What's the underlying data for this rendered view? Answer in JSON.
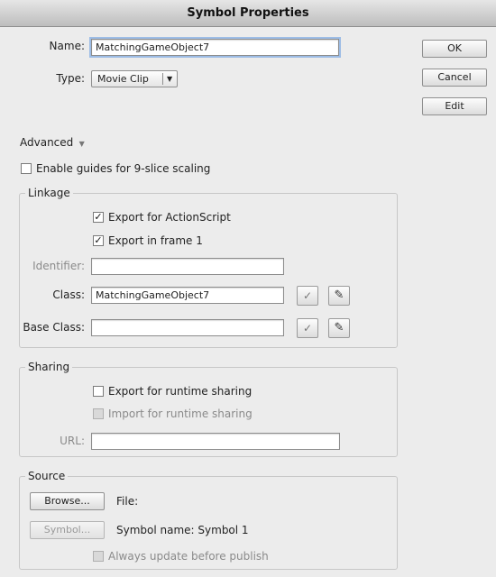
{
  "window": {
    "title": "Symbol Properties"
  },
  "form": {
    "name_label": "Name:",
    "name_value": "MatchingGameObject7",
    "type_label": "Type:",
    "type_value": "Movie Clip"
  },
  "buttons": {
    "ok": "OK",
    "cancel": "Cancel",
    "edit": "Edit"
  },
  "advanced": {
    "label": "Advanced",
    "nine_slice_label": "Enable guides for 9-slice scaling",
    "nine_slice_checked": false
  },
  "linkage": {
    "title": "Linkage",
    "export_actionscript_label": "Export for ActionScript",
    "export_actionscript_checked": true,
    "export_frame1_label": "Export in frame 1",
    "export_frame1_checked": true,
    "identifier_label": "Identifier:",
    "identifier_value": "",
    "class_label": "Class:",
    "class_value": "MatchingGameObject7",
    "base_class_label": "Base Class:",
    "base_class_value": ""
  },
  "sharing": {
    "title": "Sharing",
    "export_runtime_label": "Export for runtime sharing",
    "export_runtime_checked": false,
    "import_runtime_label": "Import for runtime sharing",
    "import_runtime_checked": false,
    "url_label": "URL:",
    "url_value": ""
  },
  "source": {
    "title": "Source",
    "browse_label": "Browse...",
    "file_label": "File:",
    "symbol_label": "Symbol...",
    "symbol_name_text": "Symbol name: Symbol 1",
    "always_update_label": "Always update before publish",
    "always_update_checked": false
  },
  "icons": {
    "validate": "check-icon",
    "edit": "pencil-icon",
    "disclosure": "triangle-down-icon",
    "dropdown": "triangle-down-icon"
  }
}
